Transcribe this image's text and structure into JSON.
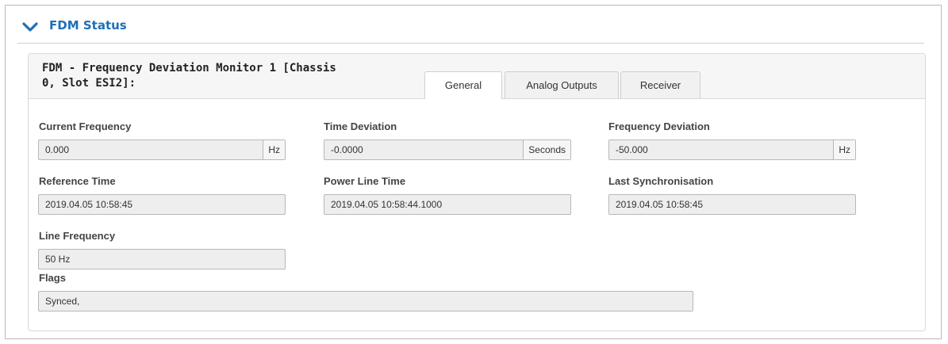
{
  "section": {
    "title": "FDM Status",
    "icon": "chevron-down-icon",
    "accent": "#1d6fb8"
  },
  "panel": {
    "title_line1": "FDM - Frequency Deviation Monitor 1 [Chassis",
    "title_line2": "0, Slot ESI2]:",
    "tabs": [
      {
        "label": "General",
        "active": true
      },
      {
        "label": "Analog Outputs",
        "active": false
      },
      {
        "label": "Receiver",
        "active": false
      }
    ]
  },
  "fields": {
    "current_frequency": {
      "label": "Current Frequency",
      "value": "0.000",
      "unit": "Hz"
    },
    "time_deviation": {
      "label": "Time Deviation",
      "value": "-0.0000",
      "unit": "Seconds"
    },
    "frequency_deviation": {
      "label": "Frequency Deviation",
      "value": "-50.000",
      "unit": "Hz"
    },
    "reference_time": {
      "label": "Reference Time",
      "value": "2019.04.05 10:58:45"
    },
    "power_line_time": {
      "label": "Power Line Time",
      "value": "2019.04.05 10:58:44.1000"
    },
    "last_synchronisation": {
      "label": "Last Synchronisation",
      "value": "2019.04.05 10:58:45"
    },
    "line_frequency": {
      "label": "Line Frequency",
      "value": "50 Hz"
    },
    "flags": {
      "label": "Flags",
      "value": "Synced,"
    }
  }
}
